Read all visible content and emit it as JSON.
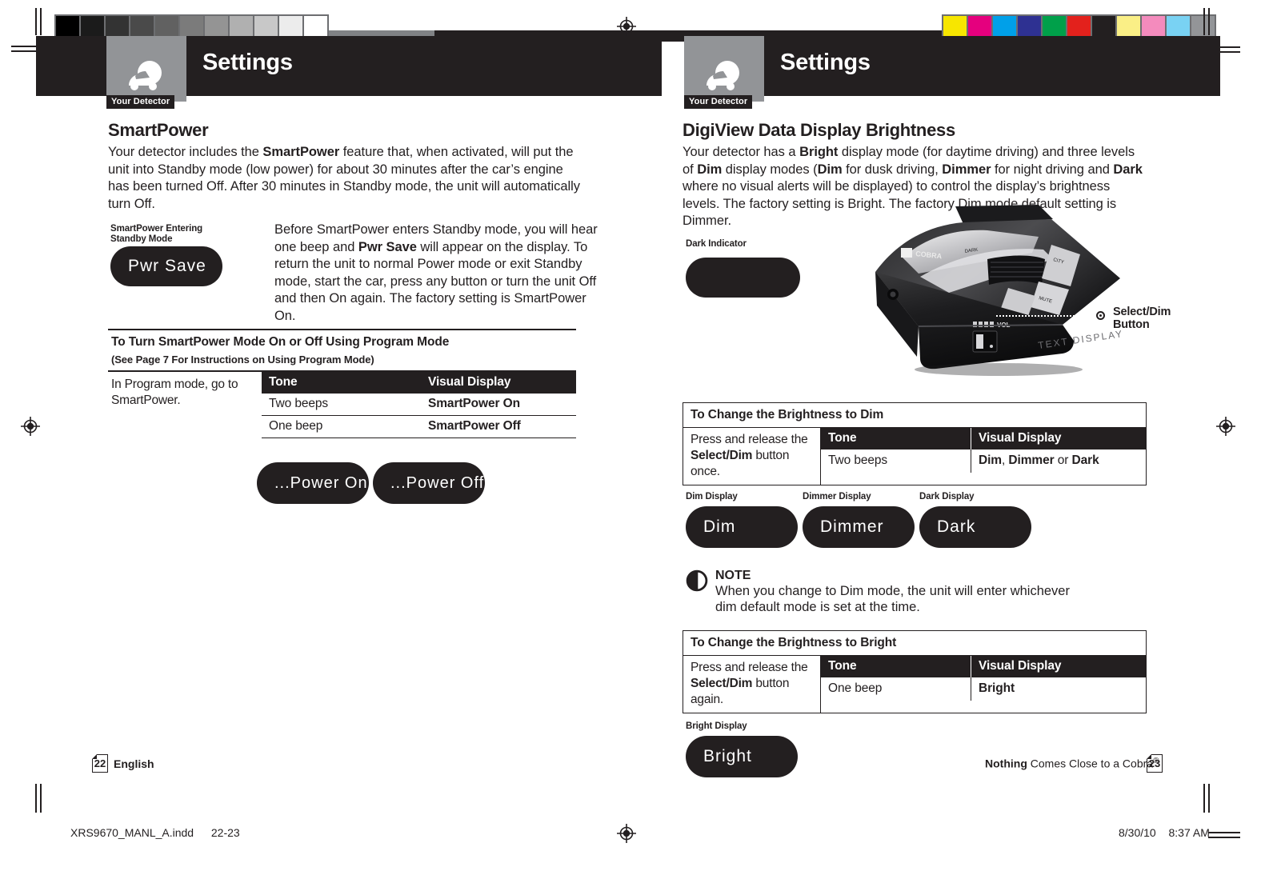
{
  "prepress": {
    "gray_steps": [
      "#000000",
      "#1b1b1b",
      "#333333",
      "#4a4a4a",
      "#616161",
      "#7b7b7b",
      "#949494",
      "#b0b0b0",
      "#c8c8c8",
      "#ececec",
      "#ffffff"
    ],
    "color_swatches": [
      "#f7e600",
      "#e5007e",
      "#00a0e9",
      "#2e3192",
      "#00a04a",
      "#e3211c",
      "#231f20",
      "#faef86",
      "#f48bbd",
      "#79d2f3",
      "#939598"
    ],
    "filename": "XRS9670_MANL_A.indd",
    "page_range": "22-23",
    "date": "8/30/10",
    "time": "8:37 AM"
  },
  "left_page": {
    "header": {
      "tab_label": "Your Detector",
      "title": "Settings",
      "icon": "detector-car-icon"
    },
    "section_title": "SmartPower",
    "intro": {
      "part1": "Your detector includes the ",
      "bold1": "SmartPower",
      "part2": " feature that, when activated, will put the unit into Standby mode (low power) for about 30 minutes after the car’s engine has been turned Off. After 30 minutes in Standby mode, the unit will automatically turn Off."
    },
    "display_caption": "SmartPower Entering Standby Mode",
    "display_value": "Pwr Save",
    "standby_text": {
      "part1": "Before SmartPower enters Standby mode, you will hear one beep and ",
      "bold1": "Pwr Save",
      "part2": " will appear on the display. To return the unit to normal Power mode or exit Standby mode, start the car, press any button or turn the unit Off and then On again. The factory setting is SmartPower On."
    },
    "table": {
      "title": "To Turn SmartPower Mode On or Off Using Program Mode",
      "subtitle": "(See Page 7 For Instructions on Using Program Mode)",
      "left_note": "In Program mode, go to SmartPower.",
      "headers": [
        "Tone",
        "Visual Display"
      ],
      "rows": [
        {
          "tone": "Two beeps",
          "display": "SmartPower On"
        },
        {
          "tone": "One beep",
          "display": "SmartPower Off"
        }
      ]
    },
    "pills": [
      "...Power On",
      "...Power Off"
    ],
    "footer": {
      "page_number": "22",
      "language": "English"
    }
  },
  "right_page": {
    "header": {
      "tab_label": "Your Detector",
      "title": "Settings",
      "icon": "detector-car-icon"
    },
    "section_title": "DigiView Data Display Brightness",
    "intro": {
      "seg": [
        {
          "t": "Your detector has a ",
          "b": false
        },
        {
          "t": "Bright",
          "b": true
        },
        {
          "t": " display mode (for daytime driving) and three levels of ",
          "b": false
        },
        {
          "t": "Dim",
          "b": true
        },
        {
          "t": " display modes (",
          "b": false
        },
        {
          "t": "Dim",
          "b": true
        },
        {
          "t": " for dusk driving, ",
          "b": false
        },
        {
          "t": "Dimmer",
          "b": true
        },
        {
          "t": " for night driving and ",
          "b": false
        },
        {
          "t": "Dark",
          "b": true
        },
        {
          "t": " where no visual alerts will be displayed) to control the display’s brightness levels. The factory setting is Bright. The factory Dim mode default setting is Dimmer.",
          "b": false
        }
      ]
    },
    "dark_indicator_caption": "Dark Indicator",
    "dark_indicator_value": "",
    "callout": {
      "label_line1": "Select/Dim",
      "label_line2": "Button"
    },
    "dim_table": {
      "title": "To Change the Brightness to Dim",
      "left_note_a": "Press and release the ",
      "left_note_b": "Select/Dim",
      "left_note_c": " button once.",
      "headers": [
        "Tone",
        "Visual Display"
      ],
      "row": {
        "tone": "Two beeps",
        "d1": "Dim",
        "sep1": ", ",
        "d2": "Dimmer",
        "sep2": " or ",
        "d3": "Dark"
      }
    },
    "dim_displays": [
      {
        "caption": "Dim Display",
        "value": "Dim"
      },
      {
        "caption": "Dimmer Display",
        "value": "Dimmer"
      },
      {
        "caption": "Dark Display",
        "value": "Dark"
      }
    ],
    "note": {
      "title": "NOTE",
      "body": "When you change to Dim mode, the unit will enter whichever dim default mode is set at the time."
    },
    "bright_table": {
      "title": "To Change the Brightness to Bright",
      "left_note_a": "Press and release the ",
      "left_note_b": "Select/Dim",
      "left_note_c": " button again.",
      "headers": [
        "Tone",
        "Visual Display"
      ],
      "row": {
        "tone": "One beep",
        "display": "Bright"
      }
    },
    "bright_display": {
      "caption": "Bright Display",
      "value": "Bright"
    },
    "footer": {
      "tagline_bold": "Nothing",
      "tagline_rest": " Comes Close to a Cobra",
      "tagline_mark": "®",
      "page_number": "23"
    }
  }
}
